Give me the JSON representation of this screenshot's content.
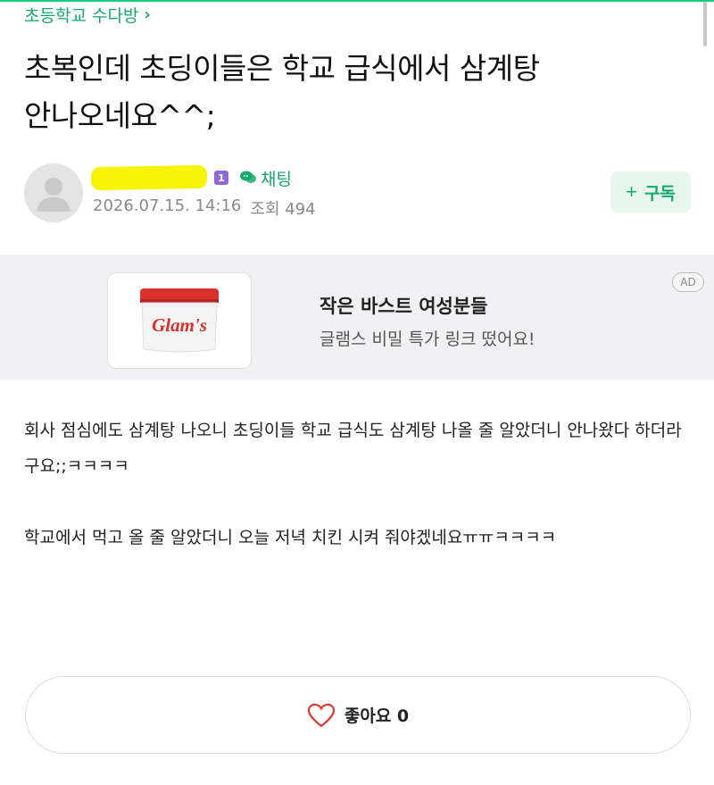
{
  "board": {
    "name": "초등학교 수다방",
    "chevron": "›"
  },
  "post": {
    "title_line1": "초복인데 초딩이들은 학교 급식에서 삼계탕",
    "title_line2": "안나오네요^^;",
    "body_p1": "회사 점심에도 삼계탕 나오니 초딩이들 학교 급식도 삼계탕 나올 줄 알았더니 안나왔다 하더라구요;;ㅋㅋㅋㅋ",
    "body_p2": "학교에서 먹고 올 줄 알았더니 오늘 저녁 치킨 시켜 줘야겠네요ㅠㅠㅋㅋㅋㅋ"
  },
  "author": {
    "level": "1",
    "chat_label": "채팅",
    "date": "2026.07.15. 14:16",
    "views_label": "조회 494"
  },
  "subscribe": {
    "label": "구독",
    "icon": "plus-icon"
  },
  "ad": {
    "title": "작은 바스트 여성분들",
    "description": "글램스 비밀 특가 링크 떴어요!",
    "badge": "AD",
    "brand": "Glam's"
  },
  "like": {
    "label": "좋아요 0",
    "icon": "heart-icon"
  },
  "colors": {
    "accent": "#17a96b",
    "highlight": "#f7f40a",
    "level_badge": "#8f6ad6",
    "ad_bg": "#f1f1f3"
  }
}
